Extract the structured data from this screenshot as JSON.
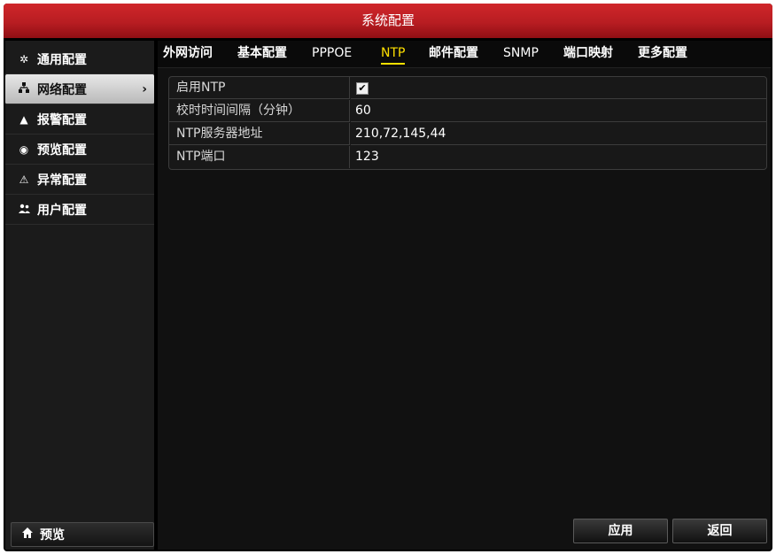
{
  "window": {
    "title": "系统配置"
  },
  "sidebar": {
    "items": [
      {
        "label": "通用配置",
        "icon": "gear-icon"
      },
      {
        "label": "网络配置",
        "icon": "network-icon",
        "active": true
      },
      {
        "label": "报警配置",
        "icon": "alarm-bell-icon"
      },
      {
        "label": "预览配置",
        "icon": "eye-icon"
      },
      {
        "label": "异常配置",
        "icon": "warning-icon"
      },
      {
        "label": "用户配置",
        "icon": "users-icon"
      }
    ],
    "preview_label": "预览",
    "preview_icon": "home-icon"
  },
  "tabs": [
    {
      "label": "外网访问"
    },
    {
      "label": "基本配置"
    },
    {
      "label": "PPPOE"
    },
    {
      "label": "NTP",
      "active": true
    },
    {
      "label": "邮件配置"
    },
    {
      "label": "SNMP"
    },
    {
      "label": "端口映射"
    },
    {
      "label": "更多配置"
    }
  ],
  "ntp": {
    "enable_label": "启用NTP",
    "enable_checked": true,
    "interval_label": "校时时间间隔（分钟）",
    "interval_value": "60",
    "server_label": "NTP服务器地址",
    "server_value": "210,72,145,44",
    "port_label": "NTP端口",
    "port_value": "123"
  },
  "footer": {
    "apply_label": "应用",
    "back_label": "返回"
  },
  "colors": {
    "titlebar": "#c0202a",
    "active_tab": "#ffe000",
    "background": "#000000"
  }
}
